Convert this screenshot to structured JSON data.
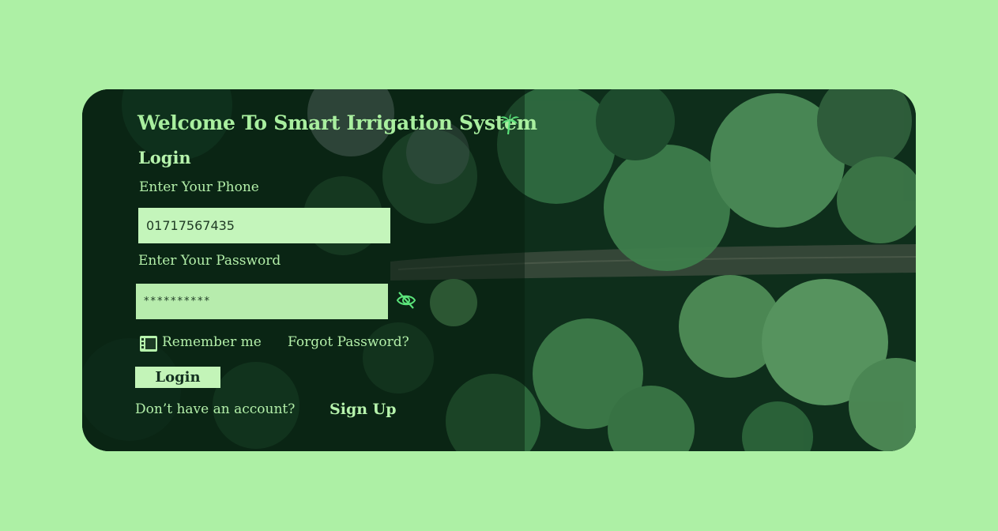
{
  "header": {
    "title": "Welcome To Smart Irrigation System",
    "palm_icon": "palm-tree-icon"
  },
  "form": {
    "heading": "Login",
    "phone": {
      "label": "Enter Your Phone",
      "value": "01717567435"
    },
    "password": {
      "label": "Enter Your Password",
      "masked_value": "**********",
      "toggle_icon": "eye-off-icon"
    },
    "remember": {
      "label": "Remember me",
      "icon": "checkbox-icon"
    },
    "forgot_label": "Forgot Password?",
    "submit_label": "Login",
    "no_account_text": "Don’t have an account?",
    "signup_label": "Sign Up"
  },
  "colors": {
    "page_background": "#adf0a5",
    "accent_text": "#b3efa9",
    "input_background": "#c4f5bb",
    "forest_dark": "#0c2a18"
  }
}
